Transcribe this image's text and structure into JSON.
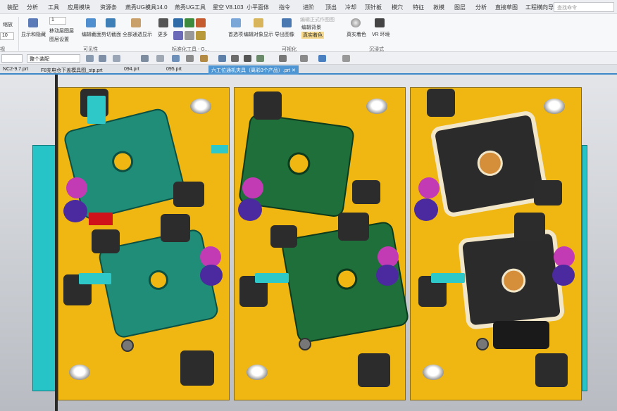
{
  "menubar": {
    "items": [
      "装配",
      "分析",
      "工具",
      "应用模块",
      "资源条",
      "燕秀UG模具14.0",
      "燕秀UG工具",
      "星空 V8.103",
      "小平面体",
      "指令",
      "进阶",
      "顶出",
      "冷却",
      "顶针板",
      "模穴",
      "特征",
      "敦模",
      "图层",
      "分析",
      "直接草图",
      "工程横向导"
    ],
    "search_placeholder": "查找命令"
  },
  "ribbon": {
    "left_labels": [
      "缩放",
      "10"
    ],
    "buttons": [
      "显示和隐藏",
      "移动层图层",
      "图层设置",
      "编辑截面",
      "剪切截面",
      "全部通透显示",
      "更多",
      "着色",
      "编辑对象显示",
      "导出图像",
      "编辑背景",
      "真实着色",
      "VR 环境",
      "首选项",
      "背景",
      "真实着色"
    ],
    "small_items": [
      "编辑背景",
      "真实着色"
    ],
    "faded_item": "编辑正式作图图",
    "spinner_value": "1",
    "groups": [
      "视",
      "可见性",
      "标准化工具 - G...",
      "可视化",
      "沉浸式"
    ]
  },
  "toolbar": {
    "filter_1": "",
    "filter_2": "整个装配"
  },
  "tabs": [
    {
      "label": "NC2-9.7.prt",
      "active": false
    },
    {
      "label": "F8充电仓下盖模具图_stp.prt",
      "active": false
    },
    {
      "label": "094.prt",
      "active": false
    },
    {
      "label": "095.prt",
      "active": false
    },
    {
      "label": "六工位通机夹具（离彩3个产品）.prt",
      "active": true
    }
  ],
  "colors": {
    "plate": "#f0b713",
    "part_green": "#1f8d78",
    "part_dark_green": "#1e6f3a",
    "gasket": "#f2e6c9",
    "fixture_cyan": "#2ec8c9",
    "tab_active": "#4e96d3"
  }
}
